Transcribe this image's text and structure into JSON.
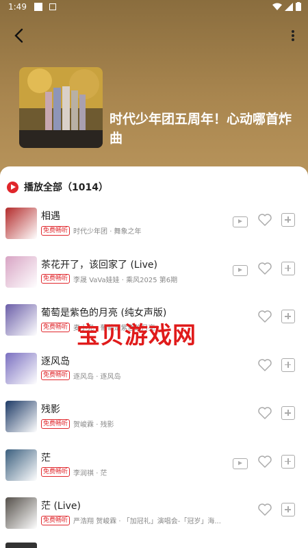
{
  "status": {
    "time": "1:49"
  },
  "header": {
    "title": "时代少年团五周年！心动哪首炸曲"
  },
  "list": {
    "play_all_label": "播放全部",
    "count": "（1014）",
    "badge": "免费畅听",
    "songs": [
      {
        "name": "相遇",
        "artist": "时代少年团 · 舞象之年",
        "mv": true,
        "thumb_color": "#b32b2b"
      },
      {
        "name": "茶花开了，该回家了 (Live)",
        "artist": "李晟 VaVa娃娃 · 乘风2025 第6期",
        "mv": true,
        "thumb_color": "#d8a4c4"
      },
      {
        "name": "葡萄是紫色的月亮 (纯女声版)",
        "artist": "麦小兜 · 葡萄是紫色的月亮",
        "mv": false,
        "thumb_color": "#6b5ea8"
      },
      {
        "name": "逐风岛",
        "artist": "逐风岛 · 逐风岛",
        "mv": false,
        "thumb_color": "#7a6fc0"
      },
      {
        "name": "残影",
        "artist": "贺峻霖 · 残影",
        "mv": false,
        "thumb_color": "#1d3a66"
      },
      {
        "name": "茫",
        "artist": "李润祺 · 茫",
        "mv": true,
        "thumb_color": "#3b5f7e"
      },
      {
        "name": "茫 (Live)",
        "artist": "严浩翔 贺峻霖 · 「加冠礼」演唱会-「冠岁」海...",
        "mv": false,
        "thumb_color": "#55504a"
      }
    ]
  },
  "watermark": "宝贝游戏网",
  "colors": {
    "accent": "#e0262b",
    "header": "#a9864f"
  }
}
